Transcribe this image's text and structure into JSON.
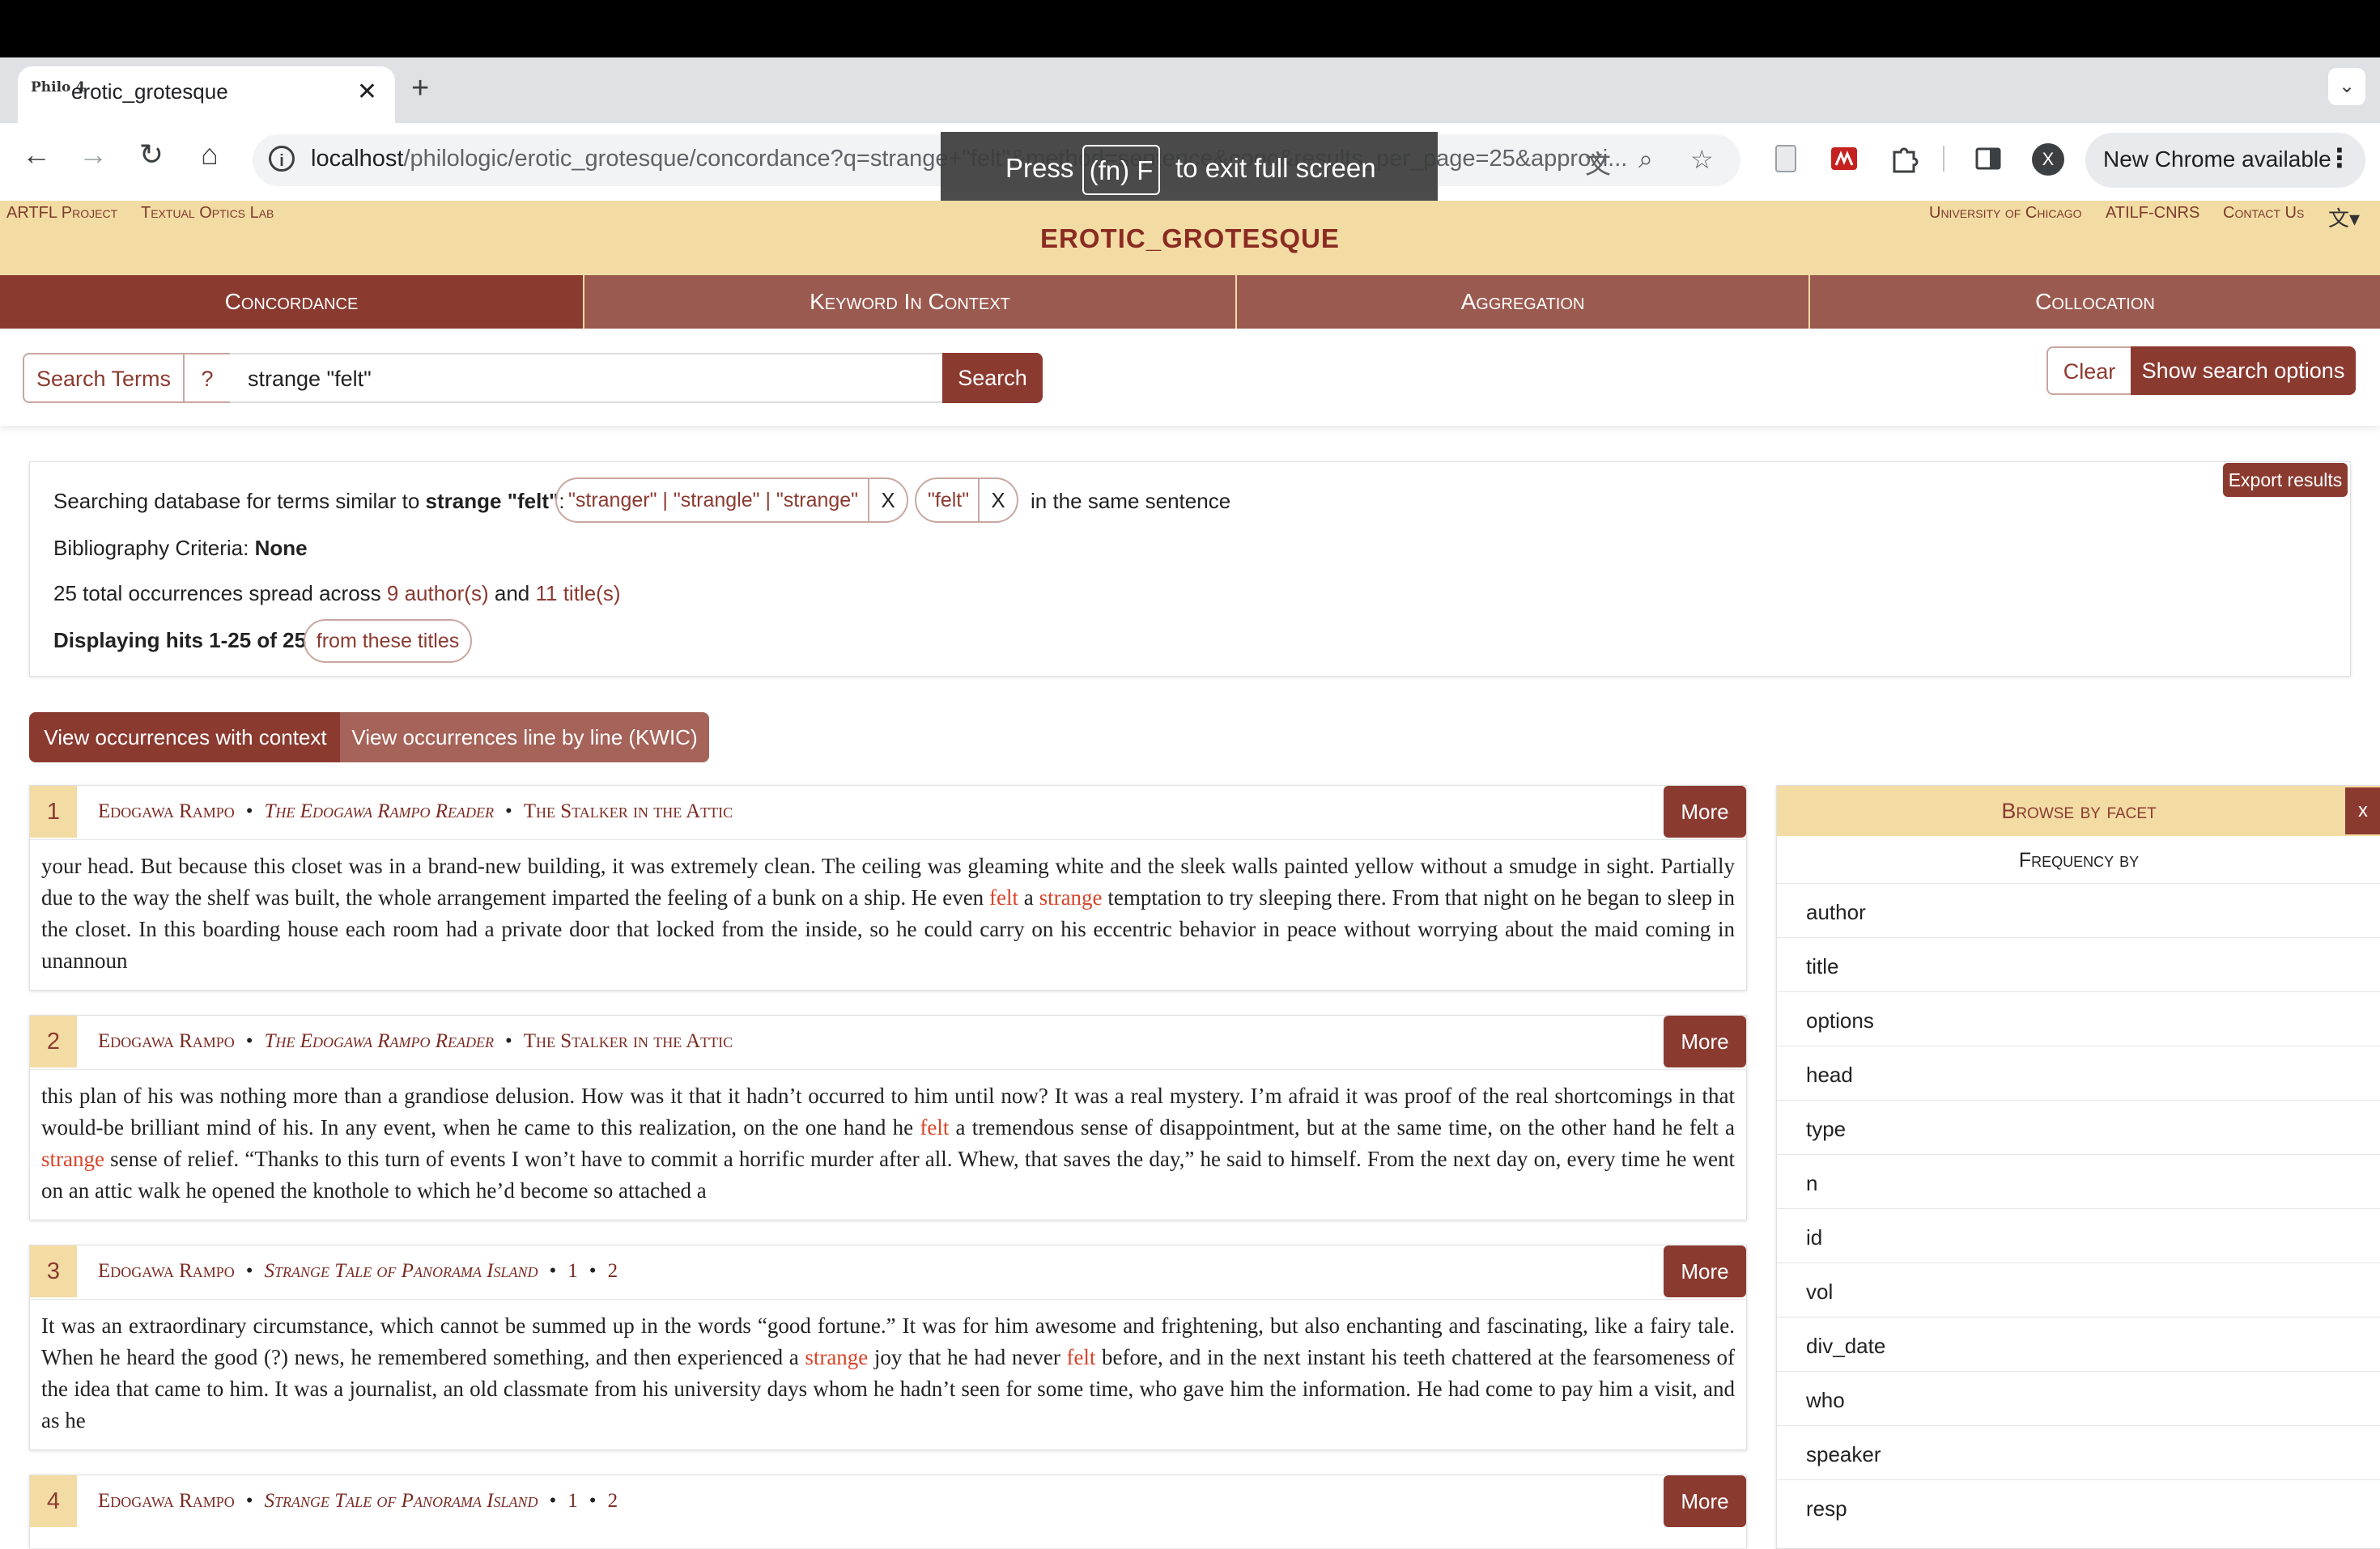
{
  "browser": {
    "tab_title": "erotic_grotesque",
    "favicon_text": "Philo 4",
    "new_tab": "+",
    "url_host": "localhost",
    "url_path": "/philologic/erotic_grotesque/concordance?q=strange+\"felt\"&method=sentence&cooc&results_per_page=25&approxi...",
    "chrome_update": "New Chrome available",
    "profile_initial": "X",
    "fullscreen_press": "Press",
    "fullscreen_key": "(fn) F",
    "fullscreen_rest": "to exit full screen"
  },
  "header": {
    "left_links": [
      "ARTFL Project",
      "Textual Optics Lab"
    ],
    "right_links": [
      "University of Chicago",
      "ATILF-CNRS",
      "Contact Us"
    ],
    "site_title": "EROTIC_GROTESQUE"
  },
  "nav_tabs": [
    "Concordance",
    "Keyword In Context",
    "Aggregation",
    "Collocation"
  ],
  "search": {
    "search_terms_label": "Search Terms",
    "help_label": "?",
    "query": "strange \"felt\"",
    "search_button": "Search",
    "clear_button": "Clear",
    "options_button": "Show search options"
  },
  "summary": {
    "export_button": "Export results",
    "searching_prefix": "Searching database for terms similar to",
    "searching_query": "strange \"felt\"",
    "term1": "\"stranger\" | \"strangle\" | \"strange\"",
    "term2": "\"felt\"",
    "remove": "X",
    "same_sentence": "in the same sentence",
    "biblio_label": "Bibliography Criteria:",
    "biblio_value": "None",
    "occ_prefix": "25 total occurrences spread across",
    "authors_link": "9 author(s)",
    "and": "and",
    "titles_link": "11 title(s)",
    "displaying": "Displaying hits 1-25 of 25",
    "from_titles": "from these titles"
  },
  "view_buttons": {
    "context": "View occurrences with context",
    "kwic": "View occurrences line by line (KWIC)"
  },
  "more_label": "More",
  "occurrences": [
    {
      "num": "1",
      "author": "Edogawa Rampo",
      "work": "The Edogawa Rampo Reader",
      "section": "The Stalker in the Attic",
      "t1": "your head. But because this closet was in a brand-new building, it was extremely clean. The ceiling was gleaming white and the sleek walls painted yellow without a smudge in sight. Partially due to the way the shelf was built, the whole arrangement imparted the feeling of a bunk on a ship. He even ",
      "h1": "felt",
      "t2": " a ",
      "h2": "strange",
      "t3": " temptation to try sleeping there. From that night on he began to sleep in the closet. In this boarding house each room had a private door that locked from the inside, so he could carry on his eccentric behavior in peace without worrying about the maid coming in unannoun"
    },
    {
      "num": "2",
      "author": "Edogawa Rampo",
      "work": "The Edogawa Rampo Reader",
      "section": "The Stalker in the Attic",
      "t1": "this plan of his was nothing more than a grandiose delusion. How was it that it hadn’t occurred to him until now? It was a real mystery. I’m afraid it was proof of the real shortcomings in that would-be brilliant mind of his. In any event, when he came to this realization, on the one hand he ",
      "h1": "felt",
      "t2": " a tremendous sense of disappointment, but at the same time, on the other hand he felt a ",
      "h2": "strange",
      "t3": " sense of relief. “Thanks to this turn of events I won’t have to commit a horrific murder after all. Whew, that saves the day,” he said to himself. From the next day on, every time he went on an attic walk he opened the knothole to which he’d become so attached a"
    },
    {
      "num": "3",
      "author": "Edogawa Rampo",
      "work": "Strange Tale of Panorama Island",
      "section": "1",
      "section2": "2",
      "t1": "It was an extraordinary circumstance, which cannot be summed up in the words “good fortune.” It was for him awesome and frightening, but also enchanting and fascinating, like a fairy tale. When he heard the good (?) news, he remembered something, and then experienced a ",
      "h1": "strange",
      "t2": " joy that he had never ",
      "h2": "felt",
      "t3": " before, and in the next instant his teeth chattered at the fearsomeness of the idea that came to him. It was a journalist, an old classmate from his university days whom he hadn’t seen for some time, who gave him the information. He had come to pay him a visit, and as he"
    },
    {
      "num": "4",
      "author": "Edogawa Rampo",
      "work": "Strange Tale of Panorama Island",
      "section": "1",
      "section2": "2"
    }
  ],
  "facets": {
    "title": "Browse by facet",
    "close": "x",
    "subtitle": "Frequency by",
    "items": [
      "author",
      "title",
      "options",
      "head",
      "type",
      "n",
      "id",
      "vol",
      "div_date",
      "who",
      "speaker",
      "resp"
    ]
  },
  "colors": {
    "accent": "#8b3a30",
    "header_bg": "#f3dca4",
    "highlight": "#d7452a"
  }
}
